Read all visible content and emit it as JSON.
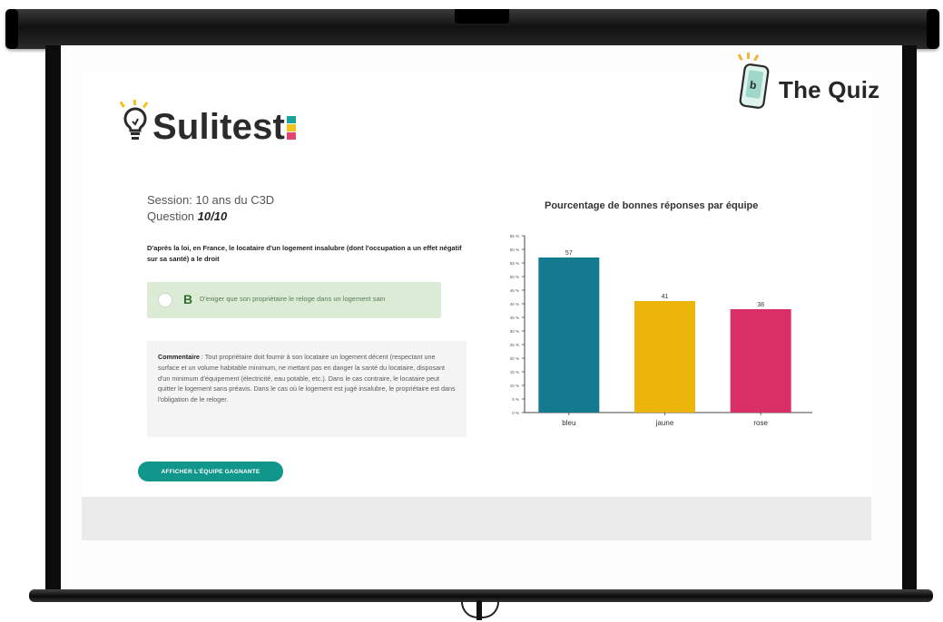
{
  "brand": {
    "quiz_title": "The Quiz",
    "logo_text": "Sulitest"
  },
  "session": {
    "label": "Session: 10 ans du C3D"
  },
  "question": {
    "label": "Question ",
    "number": "10/10"
  },
  "question_text": "D'après la loi, en France, le locataire d'un logement insalubre (dont l'occupation a un effet négatif sur sa santé) a le droit",
  "answer": {
    "letter": "B",
    "text": "D'exiger que son propriétaire le reloge dans un logement sain"
  },
  "comment": {
    "label": "Commentaire",
    "text": " : Tout propriétaire doit fournir à son locataire un logement décent (respectant une surface et un volume habitable minimum, ne mettant pas en danger la santé du locataire, disposant d'un minimum d'équipement (électricité, eau potable, etc.). Dans le cas contraire, le locataire peut quitter le logement sans préavis. Dans le cas où le logement est jugé insalubre, le propriétaire est dans l'obligation de le reloger."
  },
  "button": {
    "label": "AFFICHER L'ÉQUIPE GAGNANTE"
  },
  "colors": {
    "accent": "#10968b",
    "answer_bg": "#dcebd6",
    "bleu": "#147a8f",
    "jaune": "#edb50c",
    "rose": "#d92e66"
  },
  "icons": {
    "quiz": "phone-quiz-icon",
    "logo": "lightbulb-icon"
  },
  "chart_data": {
    "type": "bar",
    "title": "Pourcentage de bonnes réponses par équipe",
    "categories": [
      "bleu",
      "jaune",
      "rose"
    ],
    "values": [
      57,
      41,
      38
    ],
    "colors": [
      "#147a8f",
      "#edb50c",
      "#d92e66"
    ],
    "yticks": [
      "0 %",
      "5 %",
      "10 %",
      "15 %",
      "20 %",
      "25 %",
      "30 %",
      "35 %",
      "40 %",
      "45 %",
      "50 %",
      "55 %",
      "60 %",
      "65 %"
    ],
    "ylim": [
      0,
      65
    ],
    "xlabel": "",
    "ylabel": "",
    "grid": false
  }
}
